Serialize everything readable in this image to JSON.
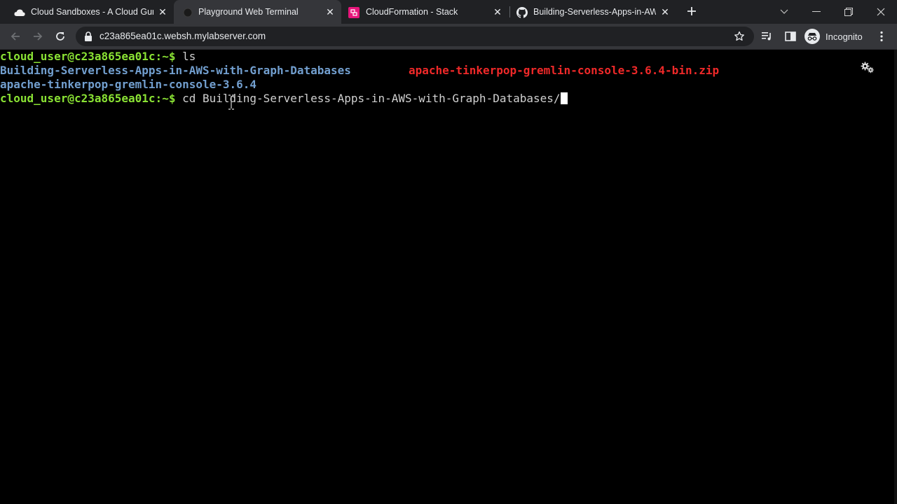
{
  "tabs": [
    {
      "title": "Cloud Sandboxes - A Cloud Guru",
      "icon": "cloud-icon",
      "active": false
    },
    {
      "title": "Playground Web Terminal",
      "icon": "terminal-favicon-icon",
      "active": true
    },
    {
      "title": "CloudFormation - Stack",
      "icon": "cloudformation-icon",
      "active": false
    },
    {
      "title": "Building-Serverless-Apps-in-AWS-with-Graph-Databases",
      "icon": "github-icon",
      "active": false
    }
  ],
  "toolbar": {
    "url": "c23a865ea01c.websh.mylabserver.com",
    "profile_label": "Incognito"
  },
  "terminal": {
    "line1": {
      "prompt": "cloud_user@c23a865ea01c:~$",
      "command": " ls"
    },
    "line2": {
      "dir": "Building-Serverless-Apps-in-AWS-with-Graph-Databases",
      "zip": "apache-tinkerpop-gremlin-console-3.6.4-bin.zip"
    },
    "line3": {
      "dir": "apache-tinkerpop-gremlin-console-3.6.4"
    },
    "line4": {
      "prompt": "cloud_user@c23a865ea01c:~$",
      "command": " cd Building-Serverless-Apps-in-AWS-with-Graph-Databases/"
    }
  },
  "colors": {
    "prompt": "#8ae234",
    "directory": "#729fcf",
    "archive": "#ef2929",
    "tab_bar": "#202124",
    "toolbar": "#35363a"
  }
}
